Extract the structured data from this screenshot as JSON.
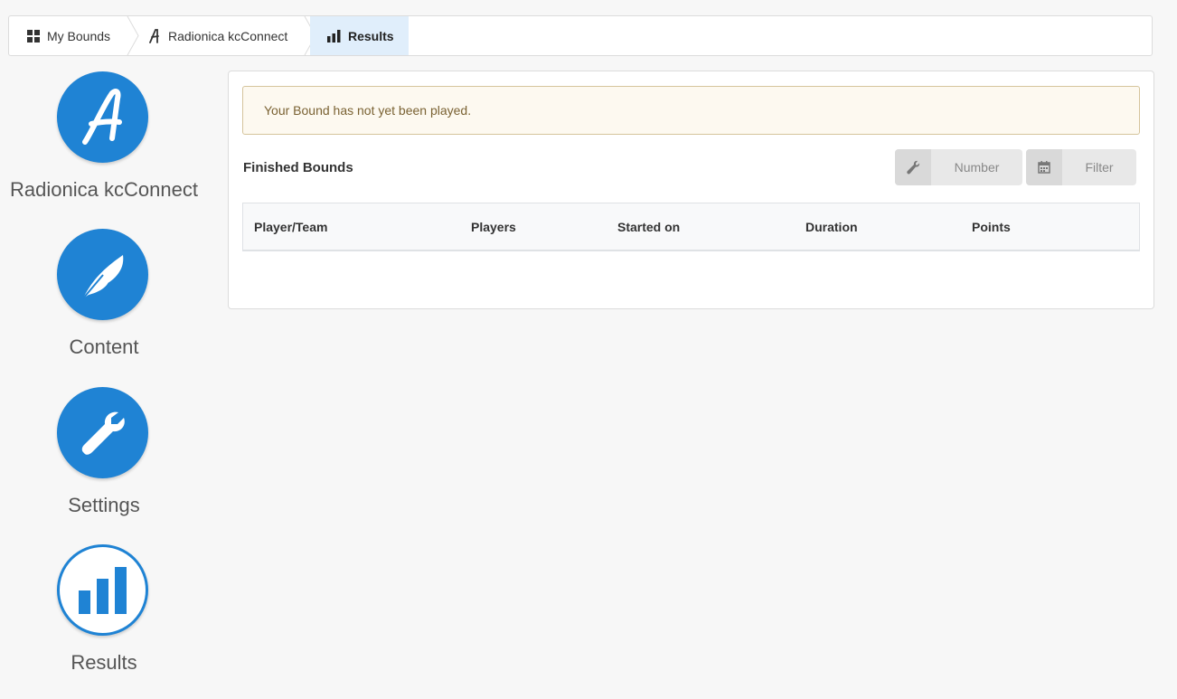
{
  "breadcrumb": {
    "items": [
      {
        "label": "My Bounds",
        "icon": "grid-icon"
      },
      {
        "label": "Radionica kcConnect",
        "icon": "bound-logo-icon"
      },
      {
        "label": "Results",
        "icon": "bar-chart-icon"
      }
    ]
  },
  "sidebar": {
    "items": [
      {
        "label": "Radionica kcConnect",
        "icon": "bound-logo-icon"
      },
      {
        "label": "Content",
        "icon": "quill-icon"
      },
      {
        "label": "Settings",
        "icon": "wrench-icon"
      },
      {
        "label": "Results",
        "icon": "bar-chart-icon",
        "active": true
      }
    ]
  },
  "main": {
    "alert": "Your Bound has not yet been played.",
    "section_title": "Finished Bounds",
    "buttons": {
      "number": {
        "label": "Number",
        "icon": "wrench-icon"
      },
      "filter": {
        "label": "Filter",
        "icon": "calendar-icon"
      }
    },
    "table": {
      "columns": [
        "Player/Team",
        "Players",
        "Started on",
        "Duration",
        "Points"
      ],
      "rows": []
    }
  },
  "colors": {
    "accent": "#1f83d4",
    "active_crumb_bg": "#e0eefb",
    "alert_bg": "#fdf9f0",
    "alert_border": "#d5c49c"
  }
}
